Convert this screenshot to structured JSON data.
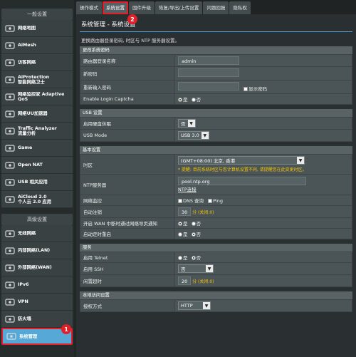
{
  "sidebar": {
    "general_header": "一般设置",
    "general_items": [
      {
        "label": "网络地图",
        "icon": "network-map-icon"
      },
      {
        "label": "AiMesh",
        "icon": "aimesh-icon"
      },
      {
        "label": "访客网络",
        "icon": "guest-network-icon"
      },
      {
        "label": "AiProtection\n智能网络卫士",
        "icon": "shield-icon"
      },
      {
        "label": "网络监控家 Adaptive\nQoS",
        "icon": "qos-icon"
      },
      {
        "label": "网络UU加速器",
        "icon": "accelerator-icon"
      },
      {
        "label": "Traffic Analyzer\n流量分析",
        "icon": "traffic-analyzer-icon"
      },
      {
        "label": "Game",
        "icon": "gamepad-icon"
      },
      {
        "label": "Open NAT",
        "icon": "open-nat-icon"
      },
      {
        "label": "USB 相关应用",
        "icon": "usb-icon"
      },
      {
        "label": "AiCloud 2.0\n个人云 2.0 应用",
        "icon": "cloud-icon"
      }
    ],
    "advanced_header": "高级设置",
    "advanced_items": [
      {
        "label": "无线网络",
        "icon": "wireless-icon"
      },
      {
        "label": "内部网络(LAN)",
        "icon": "lan-icon"
      },
      {
        "label": "外部网络(WAN)",
        "icon": "wan-icon"
      },
      {
        "label": "IPv6",
        "icon": "ipv6-icon"
      },
      {
        "label": "VPN",
        "icon": "vpn-icon"
      },
      {
        "label": "防火墙",
        "icon": "firewall-icon"
      },
      {
        "label": "系统管理",
        "icon": "admin-icon"
      }
    ],
    "badge_1": "1"
  },
  "tabs": [
    "操作模式",
    "系统设置",
    "固件升级",
    "恢复/导出/上传设置",
    "问题回报",
    "隐私权"
  ],
  "badge_2": "2",
  "main": {
    "title": "系统管理 - 系统设置",
    "description": "更换路由器登录密码, 时区与 NTP 服务器设置。",
    "sec_password": "更改系统密码",
    "login_name_label": "路由器登录名称",
    "login_name_value": "admin",
    "new_password_label": "新密码",
    "retype_password_label": "重新输入密码",
    "show_password_label": "显示密码",
    "captcha_label": "Enable Login Captcha",
    "yes": "是",
    "no": "否",
    "sec_usb": "USB 设置",
    "hdd_hibernate_label": "启用硬盘休眠",
    "hdd_hibernate_value": "否",
    "usb_mode_label": "USB Mode",
    "usb_mode_value": "USB 3.0",
    "sec_basic": "基本设置",
    "timezone_label": "时区",
    "timezone_value": "(GMT+08:00) 北京, 香港",
    "timezone_warning": "* 提醒: 目前系统时区与您计算机设置不同, 请提醒您在此变更时区。",
    "ntp_label": "NTP服务器",
    "ntp_value": "pool.ntp.org",
    "ntp_link": "NTP连接",
    "net_monitor_label": "网络监控",
    "dns_query": "DNS 查询",
    "ping": "Ping",
    "auto_logout_label": "自动注销",
    "auto_logout_value": "30",
    "auto_logout_hint": "分 (关闭:0)",
    "wan_led_label": "开启 WAN 中断时通过网络导页通知",
    "reboot_label": "启动定时重启",
    "sec_service": "服务",
    "telnet_label": "启用 Telnet",
    "ssh_label": "启用 SSH",
    "ssh_value": "否",
    "idle_label": "闲置超时",
    "idle_value": "20",
    "idle_hint": "分 (关闭:0)",
    "sec_local": "本地访问设置",
    "auth_label": "授权方式",
    "auth_value": "HTTP"
  }
}
